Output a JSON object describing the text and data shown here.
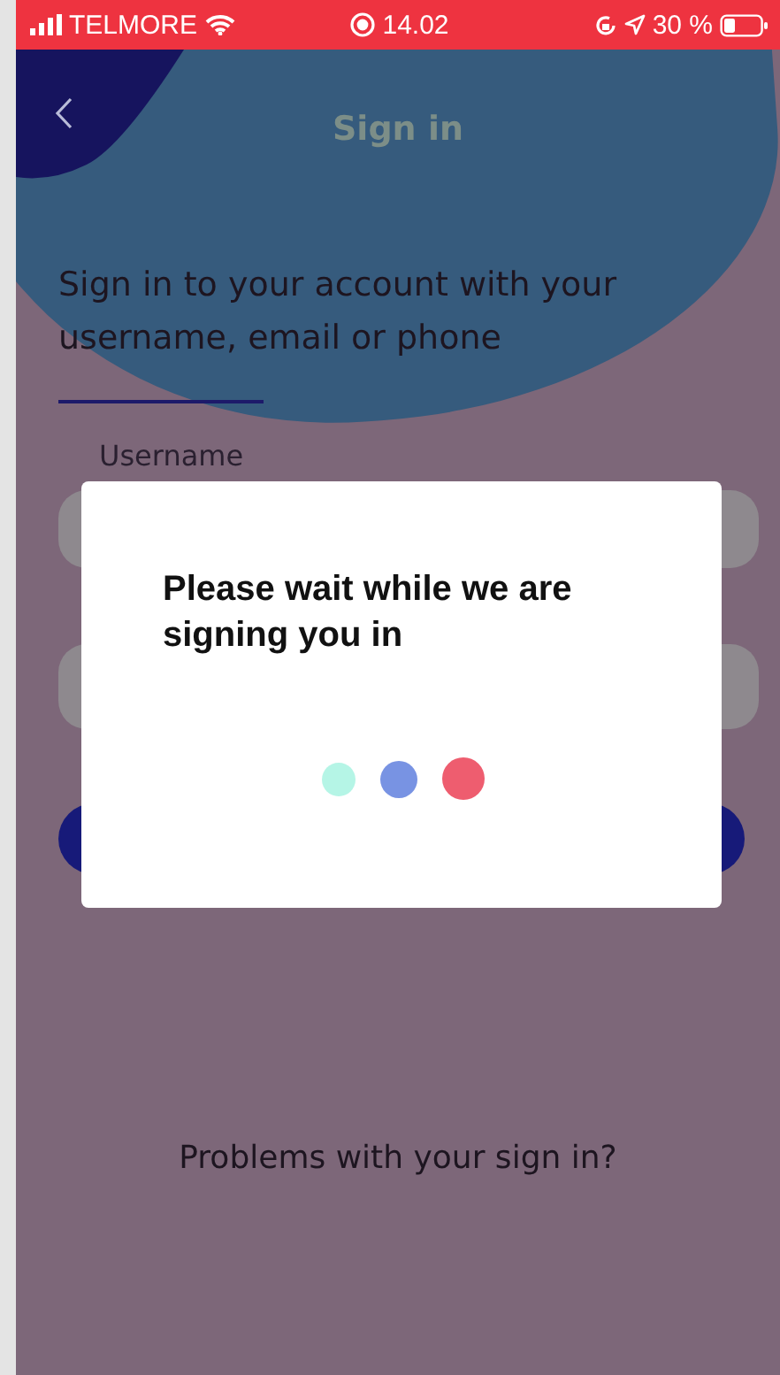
{
  "status_bar": {
    "carrier": "TELMORE",
    "time": "14.02",
    "battery": "30 %"
  },
  "header": {
    "title": "Sign in"
  },
  "intro": "Sign in to your account with your username, email or phone",
  "username_label": "Username",
  "dialog": {
    "message": "Please wait while we are signing you in",
    "dots": [
      {
        "color": "#b5f5e6"
      },
      {
        "color": "#7893e3"
      },
      {
        "color": "#ee5d6f"
      }
    ]
  },
  "help_link": "Problems with your sign in?"
}
